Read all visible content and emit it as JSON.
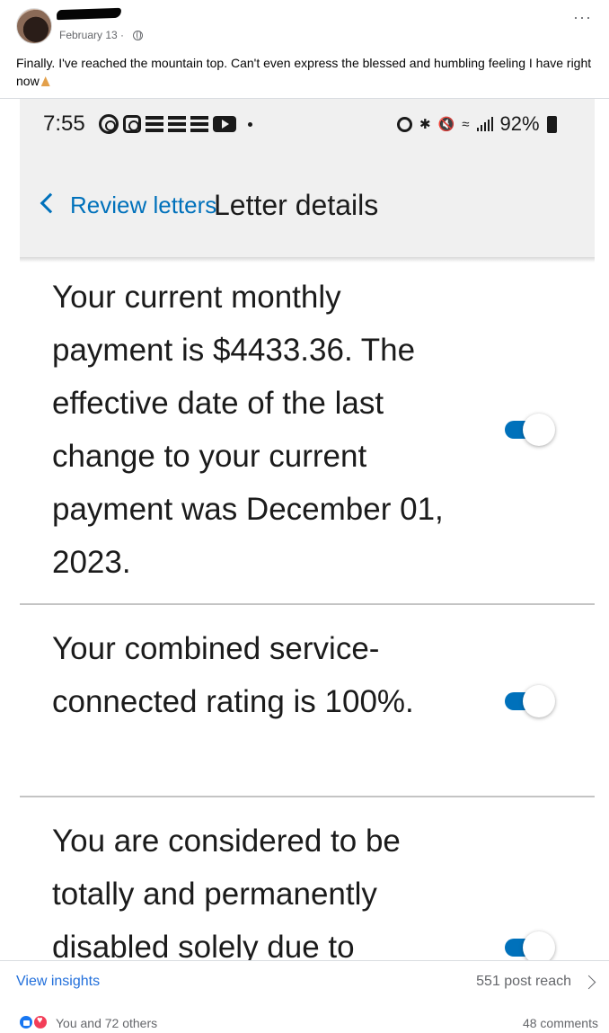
{
  "post": {
    "date": "February 13 ·",
    "more_label": "···",
    "text": "Finally. I've reached the mountain top. Can't even express the blessed and humbling feeling I have right now"
  },
  "phone": {
    "status_bar": {
      "time": "7:55",
      "battery": "92%"
    },
    "nav": {
      "back_label": "Review letters",
      "title": "Letter details"
    },
    "letters": [
      {
        "text": "Your current monthly payment is $4433.36. The effective date of the last change to your current payment was December 01, 2023.",
        "toggled": true
      },
      {
        "text": "Your combined service-connected rating is 100%.",
        "toggled": true
      },
      {
        "text": "You are considered to be totally and permanently disabled solely due to",
        "toggled": true
      }
    ],
    "toggle_color": "#0071bb"
  },
  "footer": {
    "view_insights": "View insights",
    "post_reach": "551 post reach",
    "reactors": "You and 72 others",
    "comments": "48 comments"
  },
  "icons": [
    "avatar",
    "globe-icon",
    "more-icon",
    "pray-emoji",
    "back-chevron-icon",
    "chevron-right-icon",
    "like-icon",
    "love-icon"
  ]
}
